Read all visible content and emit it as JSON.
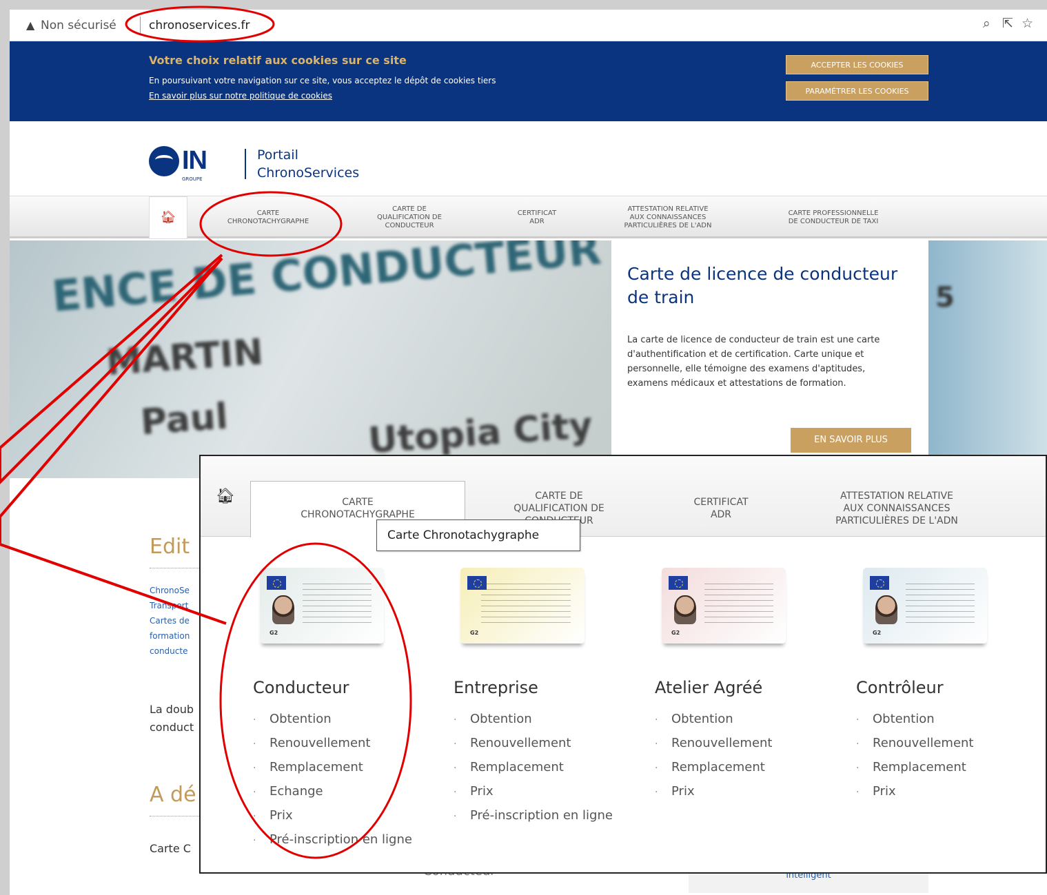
{
  "browser": {
    "security_label": "Non sécurisé",
    "url": "chronoservices.fr"
  },
  "cookie_banner": {
    "title": "Votre choix relatif aux cookies sur ce site",
    "text": "En poursuivant votre navigation sur ce site, vous acceptez le dépôt de cookies tiers",
    "link": "En savoir plus sur notre politique de cookies",
    "accept": "ACCEPTER LES COOKIES",
    "settings": "PARAMÉTRER LES COOKIES"
  },
  "header": {
    "logo_text": "IN",
    "logo_sub": "GROUPE",
    "portal_line1": "Portail",
    "portal_line2": "ChronoServices"
  },
  "nav": {
    "items": [
      "CARTE\nCHRONOTACHYGRAPHE",
      "CARTE DE\nQUALIFICATION DE\nCONDUCTEUR",
      "CERTIFICAT\nADR",
      "ATTESTATION RELATIVE\nAUX CONNAISSANCES\nPARTICULIÈRES DE L'ADN",
      "CARTE PROFESSIONNELLE\nDE CONDUCTEUR DE TAXI"
    ]
  },
  "hero": {
    "bg_text1": "ENCE DE CONDUCTEUR",
    "bg_text2": "MARTIN",
    "bg_text3": "Paul",
    "bg_text4": "Utopia City",
    "bg_text5": "5",
    "title": "Carte de licence de conducteur de train",
    "description": "La carte de licence de conducteur de train est une carte d'authentification et de certification. Carte unique et personnelle, elle témoigne des examens d'aptitudes, examens médicaux et attestations de formation.",
    "button": "EN SAVOIR PLUS"
  },
  "background_content": {
    "edit_title": "Edit",
    "edit_lines": [
      "ChronoSe",
      "Transport",
      "Cartes de",
      "formation",
      "conducte"
    ],
    "doub_line1": "La doub",
    "doub_line2": "conduct",
    "ade_title": "A dé",
    "carte_text": "Carte C",
    "conducteur_text": "Conducteur",
    "intelligent_text": "intelligent"
  },
  "zoom_menu": {
    "tabs": [
      "CARTE\nCHRONOTACHYGRAPHE",
      "CARTE DE\nQUALIFICATION DE\nCONDUCTEUR",
      "CERTIFICAT\nADR",
      "ATTESTATION RELATIVE\nAUX CONNAISSANCES\nPARTICULIÈRES DE L'ADN"
    ],
    "tooltip": "Carte Chronotachygraphe",
    "card_badge": "G2",
    "columns": [
      {
        "title": "Conducteur",
        "items": [
          "Obtention",
          "Renouvellement",
          "Remplacement",
          "Echange",
          "Prix",
          "Pré-inscription en ligne"
        ],
        "card_color": "#e3ecea"
      },
      {
        "title": "Entreprise",
        "items": [
          "Obtention",
          "Renouvellement",
          "Remplacement",
          "Prix",
          "Pré-inscription en ligne"
        ],
        "card_color": "#f6eeb8"
      },
      {
        "title": "Atelier Agréé",
        "items": [
          "Obtention",
          "Renouvellement",
          "Remplacement",
          "Prix"
        ],
        "card_color": "#f3dcdc"
      },
      {
        "title": "Contrôleur",
        "items": [
          "Obtention",
          "Renouvellement",
          "Remplacement",
          "Prix"
        ],
        "card_color": "#dde9ef"
      }
    ]
  },
  "colors": {
    "brand_blue": "#0a3480",
    "gold": "#c9a060",
    "annotation_red": "#e00000"
  }
}
